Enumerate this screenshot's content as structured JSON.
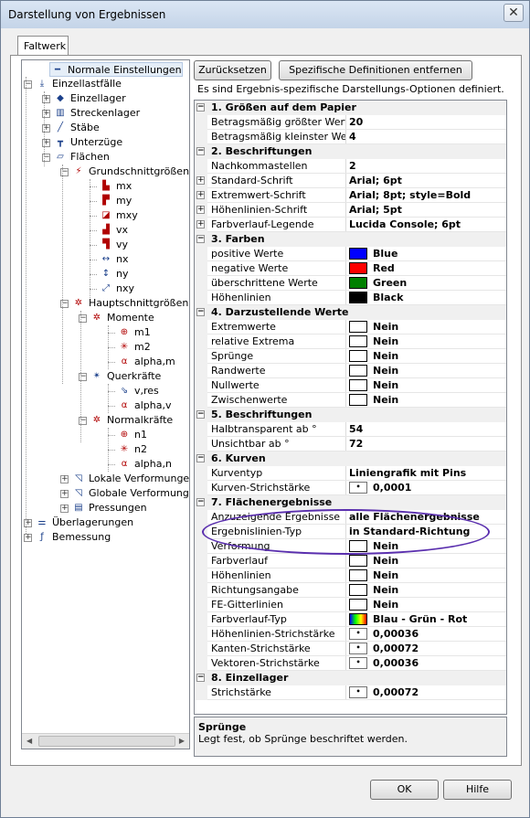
{
  "window": {
    "title": "Darstellung von Ergebnissen",
    "close_glyph": "✕"
  },
  "tab": {
    "label": "Faltwerk"
  },
  "tree": [
    {
      "label": "Normale Einstellungen",
      "icon": "line-icon"
    },
    {
      "label": "Einzellastfälle",
      "icon": "load-icon"
    },
    {
      "label": "Einzellager",
      "icon": "support-icon"
    },
    {
      "label": "Streckenlager",
      "icon": "line-support-icon"
    },
    {
      "label": "Stäbe",
      "icon": "bar-icon"
    },
    {
      "label": "Unterzüge",
      "icon": "beam-icon"
    },
    {
      "label": "Flächen",
      "icon": "surface-icon"
    },
    {
      "label": "Grundschnittgrößen",
      "icon": "forces-icon"
    },
    {
      "label": "mx",
      "icon": "mx-icon"
    },
    {
      "label": "my",
      "icon": "my-icon"
    },
    {
      "label": "mxy",
      "icon": "mxy-icon"
    },
    {
      "label": "vx",
      "icon": "vx-icon"
    },
    {
      "label": "vy",
      "icon": "vy-icon"
    },
    {
      "label": "nx",
      "icon": "nx-icon"
    },
    {
      "label": "ny",
      "icon": "ny-icon"
    },
    {
      "label": "nxy",
      "icon": "nxy-icon"
    },
    {
      "label": "Hauptschnittgrößen",
      "icon": "main-forces-icon"
    },
    {
      "label": "Momente",
      "icon": "moment-icon"
    },
    {
      "label": "m1",
      "icon": "m1-icon"
    },
    {
      "label": "m2",
      "icon": "m2-icon"
    },
    {
      "label": "alpha,m",
      "icon": "alpha-icon"
    },
    {
      "label": "Querkräfte",
      "icon": "shear-icon"
    },
    {
      "label": "v,res",
      "icon": "vres-icon"
    },
    {
      "label": "alpha,v",
      "icon": "alpha-icon"
    },
    {
      "label": "Normalkräfte",
      "icon": "normal-icon"
    },
    {
      "label": "n1",
      "icon": "n1-icon"
    },
    {
      "label": "n2",
      "icon": "n2-icon"
    },
    {
      "label": "alpha,n",
      "icon": "alpha-icon"
    },
    {
      "label": "Lokale Verformungen",
      "icon": "deform-icon"
    },
    {
      "label": "Globale Verformungen",
      "icon": "deform-icon"
    },
    {
      "label": "Pressungen",
      "icon": "pressure-icon"
    },
    {
      "label": "Überlagerungen",
      "icon": "overlay-icon"
    },
    {
      "label": "Bemessung",
      "icon": "fx-icon"
    }
  ],
  "buttons": {
    "reset": "Zurücksetzen",
    "remove_specific": "Spezifische Definitionen entfernen",
    "ok": "OK",
    "help": "Hilfe"
  },
  "info_text": "Es sind Ergebnis-spezifische Darstellungs-Optionen definiert.",
  "grid": [
    {
      "type": "cat",
      "name": "1. Größen auf dem Papier"
    },
    {
      "type": "prop",
      "name": "Betragsmäßig größter Wert [m",
      "value": "20"
    },
    {
      "type": "prop",
      "name": "Betragsmäßig kleinster Wert [n",
      "value": "4"
    },
    {
      "type": "cat",
      "name": "2. Beschriftungen"
    },
    {
      "type": "prop",
      "name": "Nachkommastellen",
      "value": "2"
    },
    {
      "type": "prop",
      "name": "Standard-Schrift",
      "value": "Arial; 6pt",
      "expand": true
    },
    {
      "type": "prop",
      "name": "Extremwert-Schrift",
      "value": "Arial; 8pt; style=Bold",
      "expand": true
    },
    {
      "type": "prop",
      "name": "Höhenlinien-Schrift",
      "value": "Arial; 5pt",
      "expand": true
    },
    {
      "type": "prop",
      "name": "Farbverlauf-Legende",
      "value": "Lucida Console; 6pt",
      "expand": true
    },
    {
      "type": "cat",
      "name": "3. Farben"
    },
    {
      "type": "prop",
      "name": "positive Werte",
      "value": "Blue",
      "swatch": "#0000ff"
    },
    {
      "type": "prop",
      "name": "negative Werte",
      "value": "Red",
      "swatch": "#ff0000"
    },
    {
      "type": "prop",
      "name": "überschrittene Werte",
      "value": "Green",
      "swatch": "#008000"
    },
    {
      "type": "prop",
      "name": "Höhenlinien",
      "value": "Black",
      "swatch": "#000000"
    },
    {
      "type": "cat",
      "name": "4. Darzustellende Werte"
    },
    {
      "type": "prop",
      "name": "Extremwerte",
      "value": "Nein",
      "swatch": "#ffffff"
    },
    {
      "type": "prop",
      "name": "relative Extrema",
      "value": "Nein",
      "swatch": "#ffffff"
    },
    {
      "type": "prop",
      "name": "Sprünge",
      "value": "Nein",
      "swatch": "#ffffff"
    },
    {
      "type": "prop",
      "name": "Randwerte",
      "value": "Nein",
      "swatch": "#ffffff"
    },
    {
      "type": "prop",
      "name": "Nullwerte",
      "value": "Nein",
      "swatch": "#ffffff"
    },
    {
      "type": "prop",
      "name": "Zwischenwerte",
      "value": "Nein",
      "swatch": "#ffffff"
    },
    {
      "type": "cat",
      "name": "5. Beschriftungen"
    },
    {
      "type": "prop",
      "name": "Halbtransparent ab °",
      "value": "54"
    },
    {
      "type": "prop",
      "name": "Unsichtbar ab °",
      "value": "72"
    },
    {
      "type": "cat",
      "name": "6. Kurven"
    },
    {
      "type": "prop",
      "name": "Kurventyp",
      "value": "Liniengrafik mit Pins"
    },
    {
      "type": "prop",
      "name": "Kurven-Strichstärke",
      "value": "0,0001",
      "dot": true
    },
    {
      "type": "cat",
      "name": "7. Flächenergebnisse"
    },
    {
      "type": "prop",
      "name": "Anzuzeigende Ergebnisse",
      "value": "alle Flächenergebnisse"
    },
    {
      "type": "prop",
      "name": "Ergebnislinien-Typ",
      "value": "in Standard-Richtung"
    },
    {
      "type": "prop",
      "name": "Verformung",
      "value": "Nein",
      "swatch": "#ffffff"
    },
    {
      "type": "prop",
      "name": "Farbverlauf",
      "value": "Nein",
      "swatch": "#ffffff"
    },
    {
      "type": "prop",
      "name": "Höhenlinien",
      "value": "Nein",
      "swatch": "#ffffff"
    },
    {
      "type": "prop",
      "name": "Richtungsangabe",
      "value": "Nein",
      "swatch": "#ffffff"
    },
    {
      "type": "prop",
      "name": "FE-Gitterlinien",
      "value": "Nein",
      "swatch": "#ffffff"
    },
    {
      "type": "prop",
      "name": "Farbverlauf-Typ",
      "value": "Blau - Grün - Rot",
      "rainbow": true
    },
    {
      "type": "prop",
      "name": "Höhenlinien-Strichstärke",
      "value": "0,00036",
      "dot": true
    },
    {
      "type": "prop",
      "name": "Kanten-Strichstärke",
      "value": "0,00072",
      "dot": true
    },
    {
      "type": "prop",
      "name": "Vektoren-Strichstärke",
      "value": "0,00036",
      "dot": true
    },
    {
      "type": "cat",
      "name": "8. Einzellager"
    },
    {
      "type": "prop",
      "name": "Strichstärke",
      "value": "0,00072",
      "dot": true
    }
  ],
  "description": {
    "title": "Sprünge",
    "text": "Legt fest, ob Sprünge beschriftet werden."
  },
  "colors": {
    "highlight_oval": "#5a2fae",
    "accent": "#0000ff"
  }
}
